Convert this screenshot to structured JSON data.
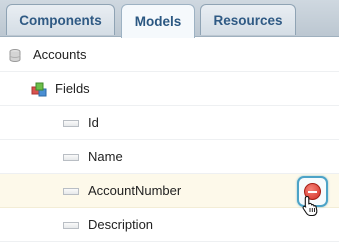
{
  "tabs": [
    {
      "label": "Components",
      "active": false
    },
    {
      "label": "Models",
      "active": true
    },
    {
      "label": "Resources",
      "active": false
    }
  ],
  "tree": {
    "root": {
      "label": "Accounts",
      "icon": "database-icon"
    },
    "group": {
      "label": "Fields",
      "icon": "model-cubes-icon"
    },
    "fields": [
      {
        "label": "Id",
        "icon": "field-icon"
      },
      {
        "label": "Name",
        "icon": "field-icon"
      },
      {
        "label": "AccountNumber",
        "icon": "field-icon",
        "hovered": true
      },
      {
        "label": "Description",
        "icon": "field-icon"
      }
    ]
  },
  "row_actions": {
    "remove_icon": "remove-minus-icon"
  },
  "colors": {
    "tab_text": "#2f5a84",
    "highlight_row": "#fdf9ea",
    "remove_button": "#d22d22",
    "focus_ring": "#4ca3c7"
  }
}
